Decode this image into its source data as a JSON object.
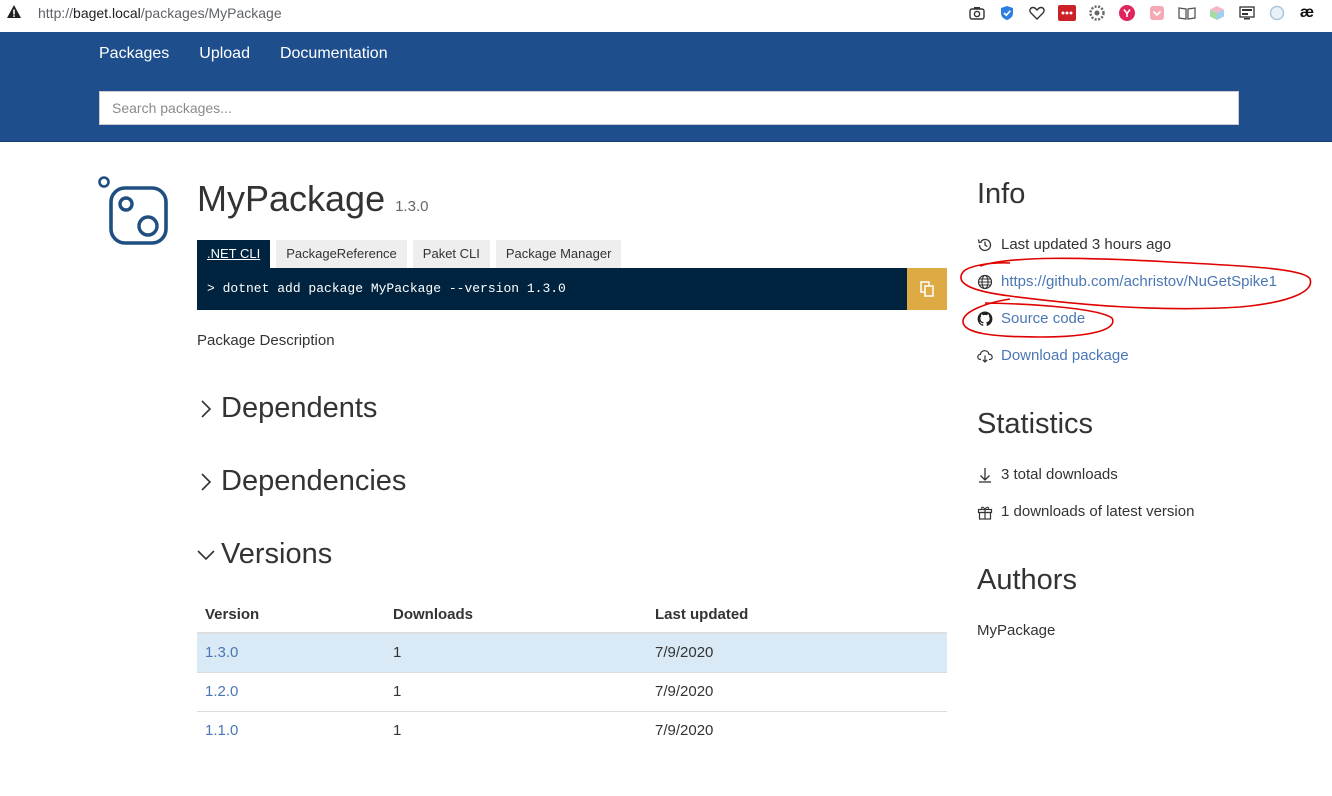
{
  "browser": {
    "url_scheme": "http://",
    "url_host": "baget.local",
    "url_path": "/packages/MyPackage",
    "ext_icons": [
      "camera-icon",
      "shield-check-icon",
      "heart-icon",
      "password-manager-icon",
      "settings-gear-icon",
      "y-icon",
      "pocket-icon",
      "reader-icon",
      "cube-icon",
      "screen-icon",
      "circle-icon",
      "ae-icon"
    ],
    "ext_ae_label": "æ"
  },
  "nav": {
    "packages": "Packages",
    "upload": "Upload",
    "documentation": "Documentation"
  },
  "search": {
    "placeholder": "Search packages..."
  },
  "package": {
    "name": "MyPackage",
    "version": "1.3.0",
    "description": "Package Description",
    "tabs": [
      ".NET CLI",
      "PackageReference",
      "Paket CLI",
      "Package Manager"
    ],
    "active_tab": ".NET CLI",
    "command": "> dotnet add package MyPackage --version 1.3.0"
  },
  "sections": {
    "dependents": "Dependents",
    "dependencies": "Dependencies",
    "versions": "Versions"
  },
  "versions_table": {
    "headers": [
      "Version",
      "Downloads",
      "Last updated"
    ],
    "rows": [
      {
        "version": "1.3.0",
        "downloads": "1",
        "updated": "7/9/2020"
      },
      {
        "version": "1.2.0",
        "downloads": "1",
        "updated": "7/9/2020"
      },
      {
        "version": "1.1.0",
        "downloads": "1",
        "updated": "7/9/2020"
      }
    ]
  },
  "info": {
    "heading": "Info",
    "last_updated": "Last updated 3 hours ago",
    "project_url": "https://github.com/achristov/NuGetSpike1",
    "source_code": "Source code",
    "download": "Download package"
  },
  "statistics": {
    "heading": "Statistics",
    "total": "3 total downloads",
    "latest": "1 downloads of latest version"
  },
  "authors": {
    "heading": "Authors",
    "names": "MyPackage"
  },
  "colors": {
    "header_bg": "#1e4e8c",
    "command_bg": "#002440",
    "copy_button": "#ddaa44",
    "link": "#4a77b4",
    "row_highlight": "#d9eaf6",
    "annotation_ink": "#e00000"
  }
}
